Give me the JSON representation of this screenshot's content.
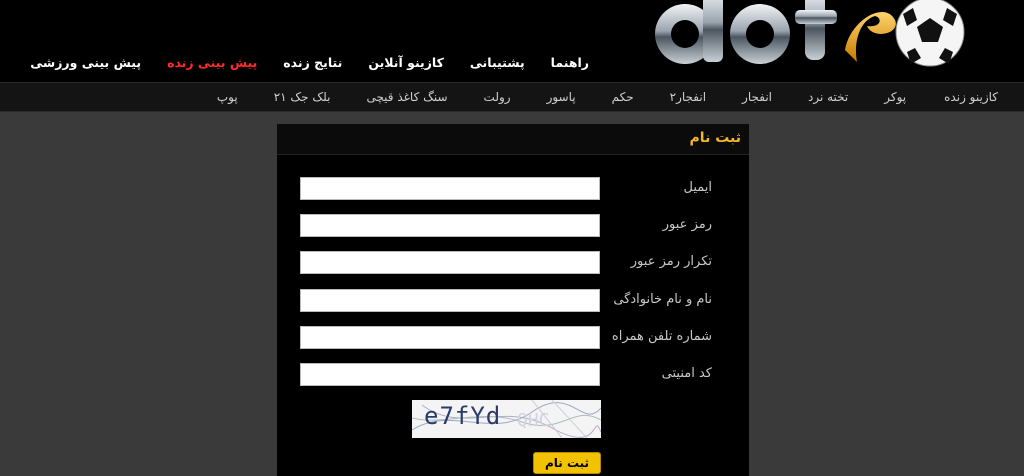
{
  "header": {
    "logo_text": "dot",
    "nav": [
      {
        "label": "پیش بینی ورزشی",
        "active": false
      },
      {
        "label": "پیش بینی زنده",
        "active": true
      },
      {
        "label": "نتایج زنده",
        "active": false
      },
      {
        "label": "کازینو آنلاین",
        "active": false
      },
      {
        "label": "پشتیبانی",
        "active": false
      },
      {
        "label": "راهنما",
        "active": false
      }
    ]
  },
  "subnav": {
    "items": [
      "کازینو زنده",
      "پوکر",
      "تخته نرد",
      "انفجار",
      "انفجار۲",
      "حکم",
      "پاسور",
      "رولت",
      "سنگ کاغذ قیچی",
      "بلک جک ۲۱",
      "پوپ"
    ]
  },
  "registration": {
    "title": "ثبت نام",
    "fields": [
      {
        "label": "ایمیل",
        "value": "",
        "placeholder": ""
      },
      {
        "label": "رمز عبور",
        "value": "",
        "placeholder": ""
      },
      {
        "label": "تکرار رمز عبور",
        "value": "",
        "placeholder": ""
      },
      {
        "label": "نام و نام خانوادگی",
        "value": "",
        "placeholder": ""
      },
      {
        "label": "شماره تلفن همراه",
        "value": "",
        "placeholder": ""
      },
      {
        "label": "کد امنیتی",
        "value": "",
        "placeholder": ""
      }
    ],
    "captcha_text": "e7fYd",
    "submit_label": "ثبت نام"
  },
  "colors": {
    "accent": "#f2b624",
    "active_nav": "#ff2a2a",
    "button": "#f2c200",
    "background": "#3a3a3a"
  }
}
